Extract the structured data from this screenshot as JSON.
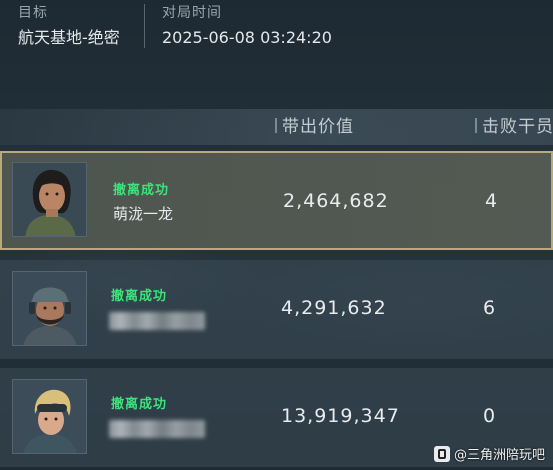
{
  "match": {
    "target_label": "目标",
    "target_value": "航天基地-绝密",
    "time_label": "对局时间",
    "time_value": "2025-06-08 03:24:20"
  },
  "columns": {
    "value_header": "带出价值",
    "kills_header": "击败干员"
  },
  "rows": [
    {
      "status": "撤离成功",
      "name": "萌泷一龙",
      "value": "2,464,682",
      "kills": "4",
      "highlighted": true
    },
    {
      "status": "撤离成功",
      "name": "",
      "value": "4,291,632",
      "kills": "6",
      "highlighted": false
    },
    {
      "status": "撤离成功",
      "name": "",
      "value": "13,919,347",
      "kills": "0",
      "highlighted": false
    }
  ],
  "watermark": {
    "text": "@三角洲陪玩吧"
  },
  "colors": {
    "status_green": "#3ee27a",
    "highlight_border": "#b9aa77"
  }
}
